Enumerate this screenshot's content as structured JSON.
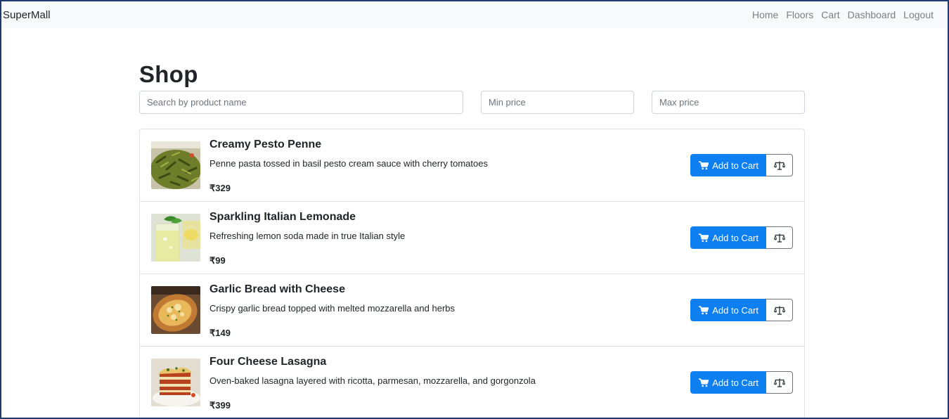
{
  "navbar": {
    "brand": "SuperMall",
    "links": [
      "Home",
      "Floors",
      "Cart",
      "Dashboard",
      "Logout"
    ]
  },
  "page": {
    "title": "Shop"
  },
  "filters": {
    "search_placeholder": "Search by product name",
    "min_placeholder": "Min price",
    "max_placeholder": "Max price"
  },
  "products": [
    {
      "name": "Creamy Pesto Penne",
      "description": "Penne pasta tossed in basil pesto cream sauce with cherry tomatoes",
      "price": "₹329",
      "cart_label": "Add to Cart",
      "image": "pesto-penne-image"
    },
    {
      "name": "Sparkling Italian Lemonade",
      "description": "Refreshing lemon soda made in true Italian style",
      "price": "₹99",
      "cart_label": "Add to Cart",
      "image": "lemonade-image"
    },
    {
      "name": "Garlic Bread with Cheese",
      "description": "Crispy garlic bread topped with melted mozzarella and herbs",
      "price": "₹149",
      "cart_label": "Add to Cart",
      "image": "garlic-bread-image"
    },
    {
      "name": "Four Cheese Lasagna",
      "description": "Oven-baked lasagna layered with ricotta, parmesan, mozzarella, and gorgonzola",
      "price": "₹399",
      "cart_label": "Add to Cart",
      "image": "lasagna-image"
    }
  ],
  "icons": {
    "cart": "cart-icon",
    "compare": "balance-scale-icon"
  },
  "colors": {
    "primary": "#0d7ff0",
    "navbar_bg": "#f8f9fa",
    "nav_link": "#7a7f85"
  }
}
